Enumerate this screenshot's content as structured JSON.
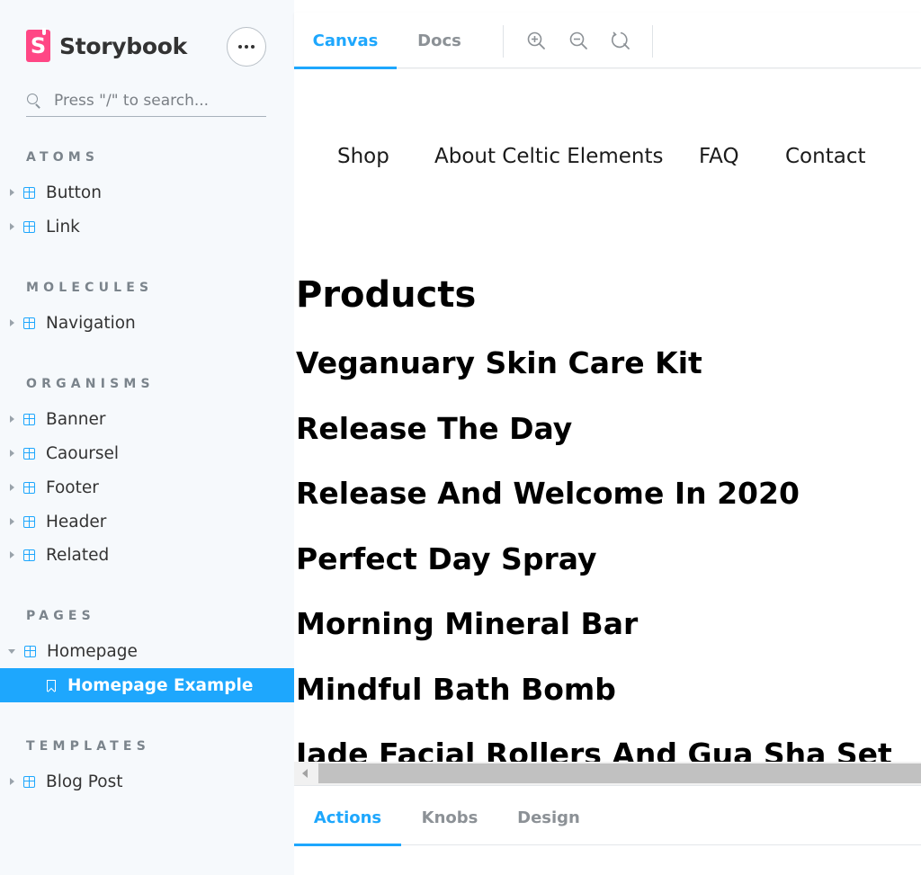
{
  "sidebar": {
    "brand_name": "Storybook",
    "search": {
      "placeholder": "Press \"/\" to search..."
    },
    "sections": [
      {
        "title": "ATOMS",
        "items": [
          {
            "label": "Button"
          },
          {
            "label": "Link"
          }
        ]
      },
      {
        "title": "MOLECULES",
        "items": [
          {
            "label": "Navigation"
          }
        ]
      },
      {
        "title": "ORGANISMS",
        "items": [
          {
            "label": "Banner"
          },
          {
            "label": "Caoursel"
          },
          {
            "label": "Footer"
          },
          {
            "label": "Header"
          },
          {
            "label": "Related"
          }
        ]
      },
      {
        "title": "PAGES",
        "items": [
          {
            "label": "Homepage",
            "expanded": true
          },
          {
            "label": "Homepage Example",
            "selected": true
          }
        ]
      },
      {
        "title": "TEMPLATES",
        "items": [
          {
            "label": "Blog Post"
          }
        ]
      }
    ]
  },
  "toolbar": {
    "tabs": [
      {
        "label": "Canvas",
        "active": true
      },
      {
        "label": "Docs",
        "active": false
      }
    ],
    "tools": [
      "zoom-in-icon",
      "zoom-out-icon",
      "reset-zoom-icon"
    ]
  },
  "canvas": {
    "nav": [
      "Shop",
      "About Celtic Elements",
      "FAQ",
      "Contact"
    ],
    "products_title": "Products",
    "products": [
      "Veganuary Skin Care Kit",
      "Release The Day",
      "Release And Welcome In 2020",
      "Perfect Day Spray",
      "Morning Mineral Bar",
      "Mindful Bath Bomb",
      "Jade Facial Rollers And Gua Sha Set"
    ]
  },
  "addons": {
    "tabs": [
      {
        "label": "Actions",
        "active": true
      },
      {
        "label": "Knobs",
        "active": false
      },
      {
        "label": "Design",
        "active": false
      }
    ]
  },
  "colors": {
    "accent": "#1ea7fd",
    "brand": "#ff4785",
    "sidebar_bg": "#f6f9fc"
  }
}
